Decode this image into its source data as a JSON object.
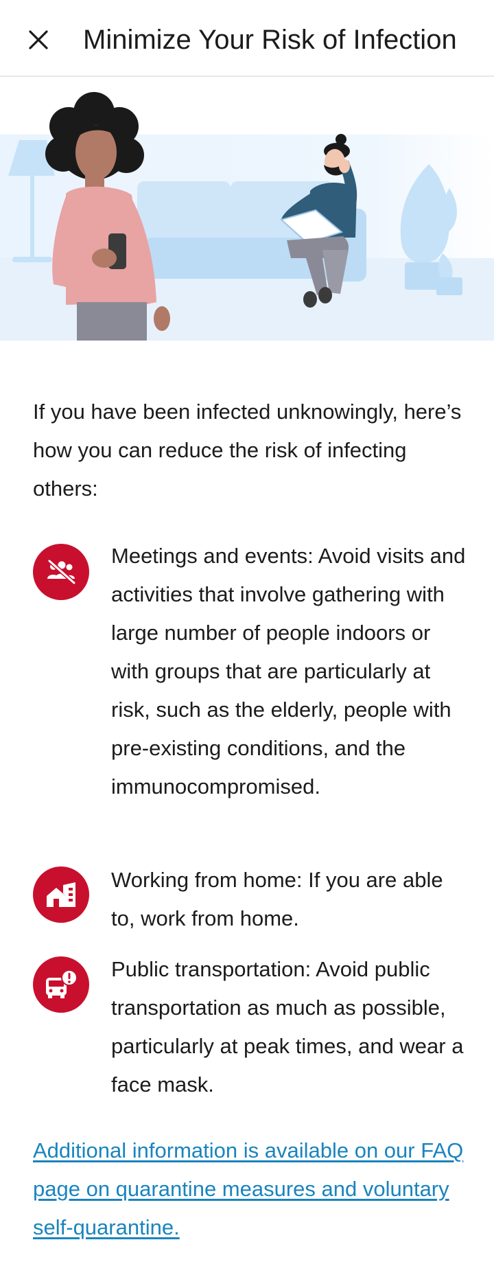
{
  "header": {
    "close_icon": "close-icon",
    "title": "Minimize Your Risk of Infection"
  },
  "hero": {
    "illustration": "people-at-home-illustration",
    "colors": {
      "floor": "#e7f2fd",
      "furniture": "#c6e2f8",
      "shirt_pink": "#e8a3a3",
      "skin_dark": "#b07a66",
      "hair": "#1a1a1a",
      "sweater_blue": "#2f5d7a",
      "pants_grey": "#8a8a96"
    }
  },
  "intro": "If you have been infected unknowingly, here’s how you can reduce the risk of infecting others:",
  "accent_color": "#c8102e",
  "tips": [
    {
      "icon": "no-gatherings-icon",
      "text": "Meetings and events: Avoid visits and activities that involve gathering with large number of people indoors or with groups that are particularly at risk, such as the elderly, people with pre-existing conditions, and the immunocompromised."
    },
    {
      "icon": "home-office-icon",
      "text": "Working from home: If you are able to, work from home."
    },
    {
      "icon": "bus-warning-icon",
      "text": "Public transportation: Avoid public transportation as much as possible, particularly at peak times, and wear a face mask."
    }
  ],
  "more_link": {
    "text": "Additional information is available on our FAQ page on quarantine measures and voluntary self-quarantine.",
    "color": "#1a84bd"
  }
}
